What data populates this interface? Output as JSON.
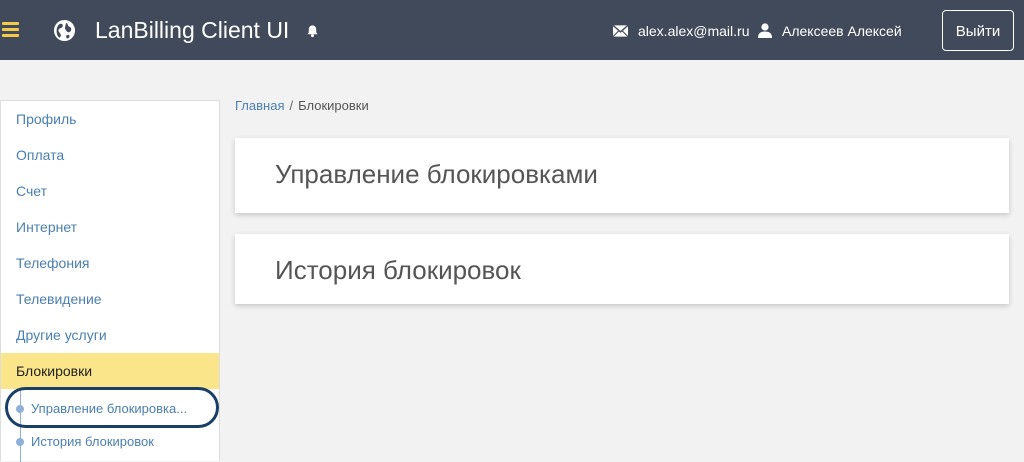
{
  "header": {
    "app_title": "LanBilling Client UI",
    "email": "alex.alex@mail.ru",
    "username": "Алексеев Алексей",
    "logout_label": "Выйти",
    "accent_color": "#f7c948",
    "background_color": "#414a5b",
    "icons": [
      "menu-icon",
      "globe-icon",
      "bell-icon",
      "mail-icon",
      "user-icon"
    ]
  },
  "sidebar": {
    "items": [
      {
        "label": "Профиль"
      },
      {
        "label": "Оплата"
      },
      {
        "label": "Счет"
      },
      {
        "label": "Интернет"
      },
      {
        "label": "Телефония"
      },
      {
        "label": "Телевидение"
      },
      {
        "label": "Другие услуги"
      },
      {
        "label": "Блокировки",
        "active": true
      }
    ],
    "subitems": [
      {
        "label": "Управление блокировка..."
      },
      {
        "label": "История блокировок"
      }
    ],
    "active_color": "#fbe58a"
  },
  "breadcrumb": {
    "home": "Главная",
    "separator": "/",
    "current": "Блокировки"
  },
  "main": {
    "panels": [
      {
        "title": "Управление блокировками"
      },
      {
        "title": "История блокировок"
      }
    ]
  }
}
